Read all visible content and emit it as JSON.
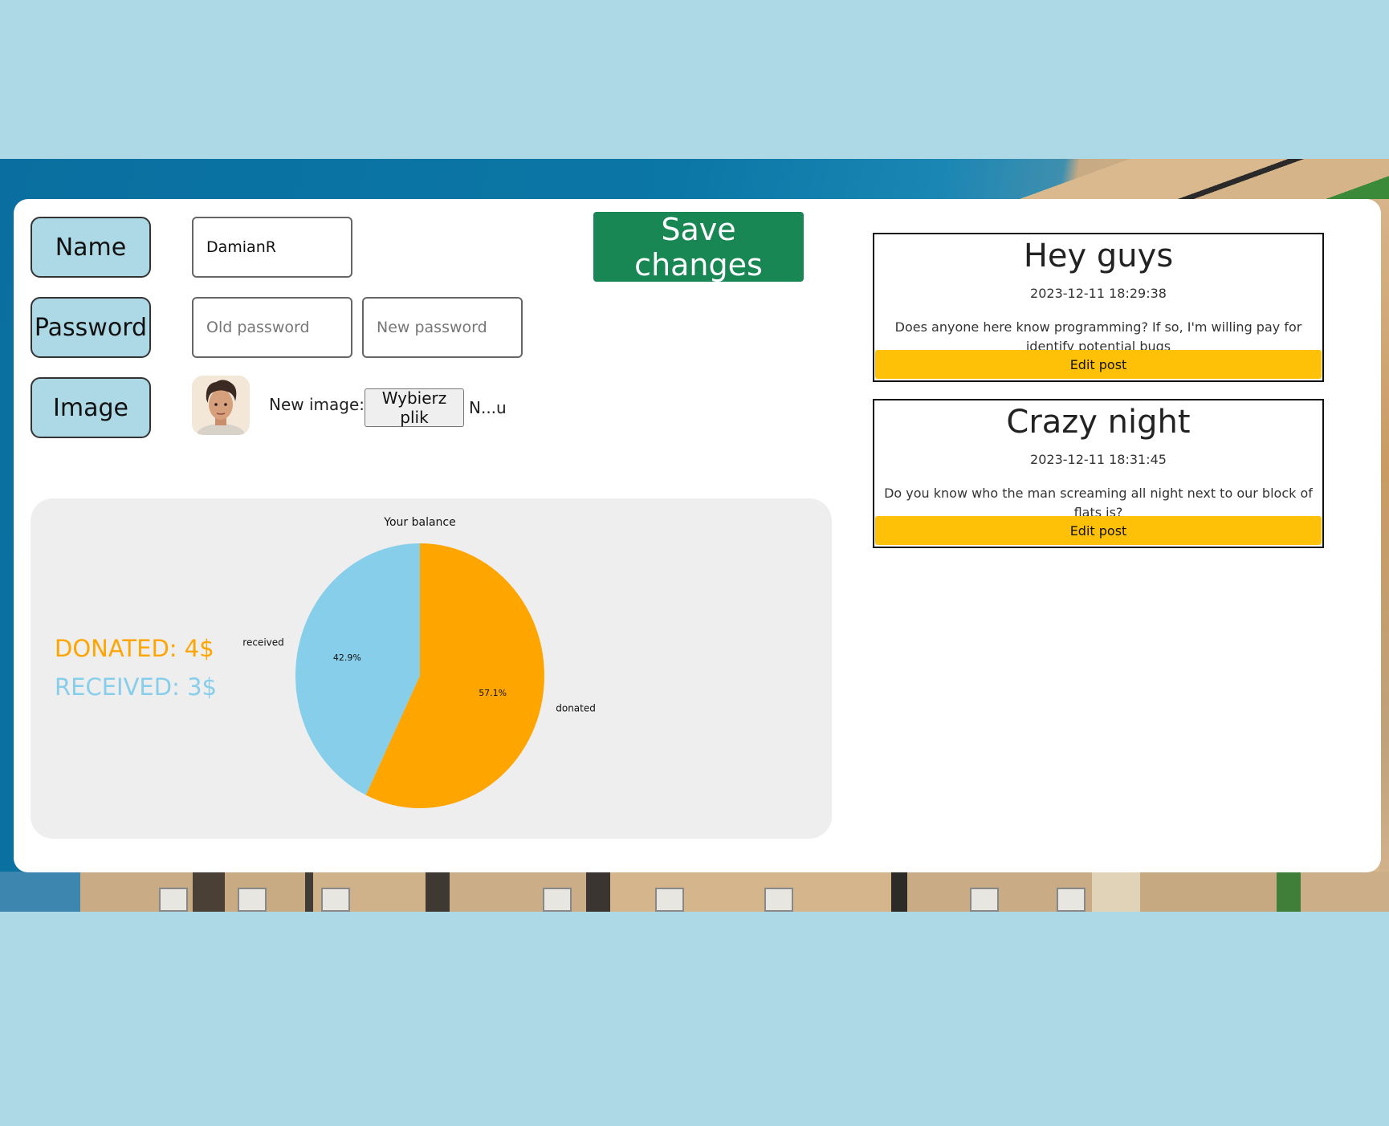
{
  "form": {
    "name_label": "Name",
    "password_label": "Password",
    "image_label": "Image",
    "name_value": "DamianR",
    "old_password_placeholder": "Old password",
    "new_password_placeholder": "New password",
    "new_image_label": "New image:",
    "file_button_label": "Wybierz plik",
    "file_name": "N...u",
    "save_label": "Save changes"
  },
  "balance": {
    "donated_text": "DONATED: 4$",
    "received_text": "RECEIVED: 3$"
  },
  "chart_data": {
    "type": "pie",
    "title": "Your balance",
    "categories": [
      "received",
      "donated"
    ],
    "values": [
      3,
      4
    ],
    "percent_labels": [
      "42.9%",
      "57.1%"
    ],
    "colors": [
      "#87ceeb",
      "#ffa500"
    ]
  },
  "posts": [
    {
      "title": "Hey guys",
      "date": "2023-12-11 18:29:38",
      "body": "Does anyone here know programming? If so, I'm willing pay for identify potential bugs",
      "edit_label": "Edit post"
    },
    {
      "title": "Crazy night",
      "date": "2023-12-11 18:31:45",
      "body": "Do you know who the man screaming all night next to our block of flats is?",
      "edit_label": "Edit post"
    }
  ]
}
